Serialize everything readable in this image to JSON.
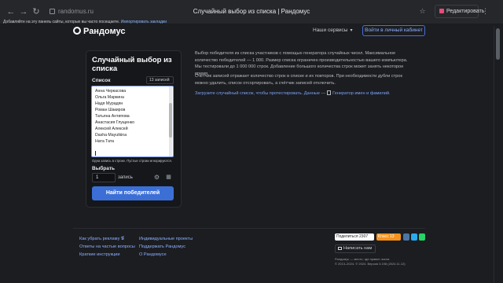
{
  "browser": {
    "url": "randomus.ru",
    "tab_title": "Случайный выбор из списка | Рандомус",
    "edit_label": "Редактировать",
    "hint_text": "Добавляйте на эту панель сайты, которые вы часто посещаете.",
    "hint_link": "Импортировать закладки"
  },
  "site": {
    "logo": "Рандомус",
    "services": "Наши сервисы",
    "login": "Войти в личный кабинет"
  },
  "tool": {
    "title": "Случайный выбор из списка",
    "list_label": "Список",
    "count_select": "13 записей",
    "entries": [
      "Анна Черкасова",
      "Ольга Маркина",
      "Надя Мурадян",
      "Роман Шакиров",
      "Татьяна Антипова",
      "Анастасия Глущенко",
      "Алексей Алексей",
      "Dasha Mayutkina",
      "Ната Тата"
    ],
    "helper": "Одна запись в строке. Пустые строки игнорируются.",
    "pick_label": "Выбрать",
    "pick_value": "1",
    "pick_unit": "запись",
    "submit": "Найти победителей"
  },
  "description": {
    "p1": "Выбор победителя из списка участников с помощью генератора случайных чисел. Максимальное количество победителей — 1 000. Размер списка ограничен производительностью вашего компьютера. Мы тестировали до 1 000 000 строк. Добавление большого количества строк может занять некоторое время.",
    "p2": "Счётчик записей отражает количество строк в списке и их повторов. При необходимости дубли строк можно удалить, список отсортировать, а счётчик записей отключить.",
    "p3_link": "Загрузите случайный список, чтобы протестировать. Данные —",
    "p3_tool": "Генератор имен и фамилий."
  },
  "footer": {
    "col1": [
      "Как убрать рекламу",
      "Ответы на частые вопросы",
      "Краткие инструкции"
    ],
    "col2": [
      "Индивидуальные проекты",
      "Поддержать Рандомус",
      "О Рандомусе"
    ],
    "share": "Поделиться",
    "share_count": "2307",
    "klass": "Класс",
    "klass_count": "13",
    "write": "Написать нам",
    "copy1": "Рандомус — место, где правят числа",
    "copy2": "© 2013–2024. © 2024. Версия 3.198 (2024.11.12)"
  },
  "colors": {
    "accent": "#3c6fd6",
    "background": "#1b1d21",
    "card": "#15171a"
  }
}
